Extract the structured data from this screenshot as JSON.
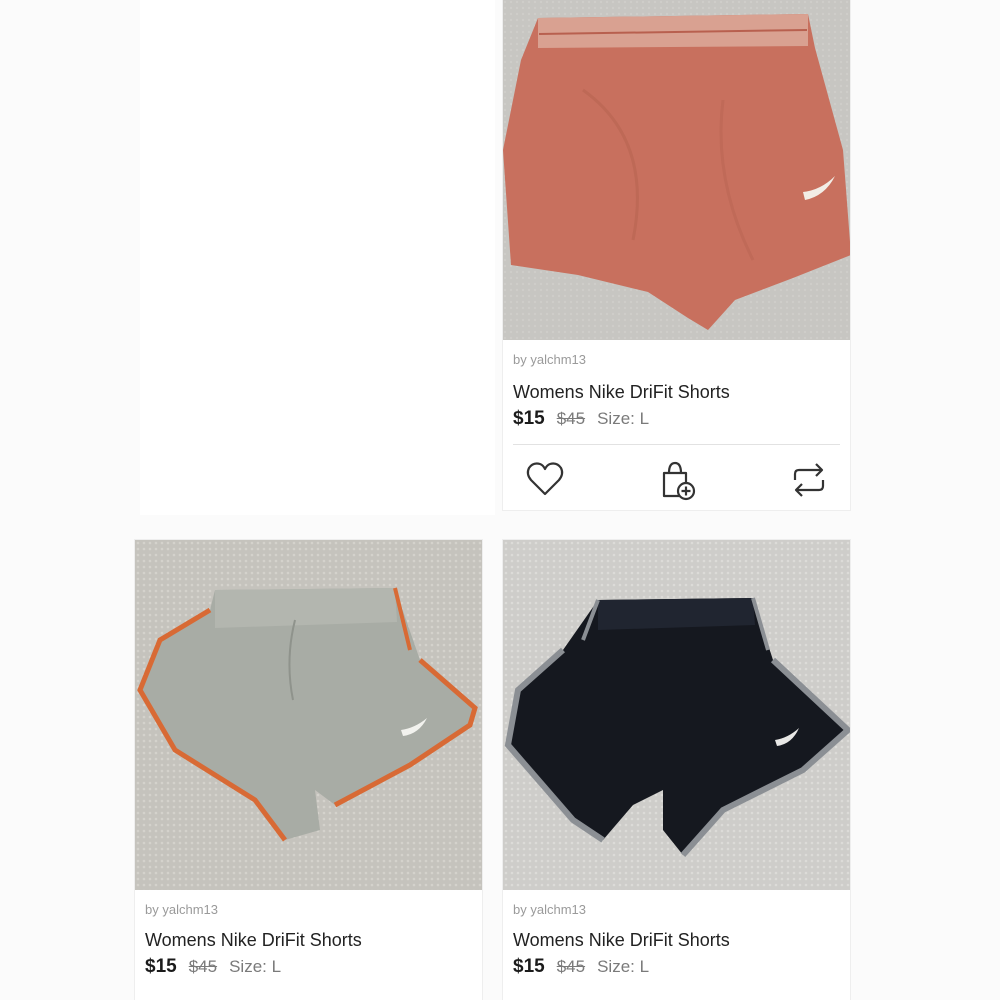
{
  "listings": [
    {
      "seller": "by yalchm13",
      "title": "Womens Nike DriFit Shorts",
      "price": "$15",
      "original_price": "$45",
      "size": "Size: L",
      "color": "#c8705e",
      "actions": [
        "heart-icon",
        "bag-add-icon",
        "repost-icon"
      ]
    },
    {
      "seller": "by yalchm13",
      "title": "Womens Nike DriFit Shorts",
      "price": "$15",
      "original_price": "$45",
      "size": "Size: L",
      "color": "#a8aca5",
      "trim_color": "#d86a35"
    },
    {
      "seller": "by yalchm13",
      "title": "Womens Nike DriFit Shorts",
      "price": "$15",
      "original_price": "$45",
      "size": "Size: L",
      "color": "#15181f",
      "trim_color": "#8b8f94"
    }
  ]
}
